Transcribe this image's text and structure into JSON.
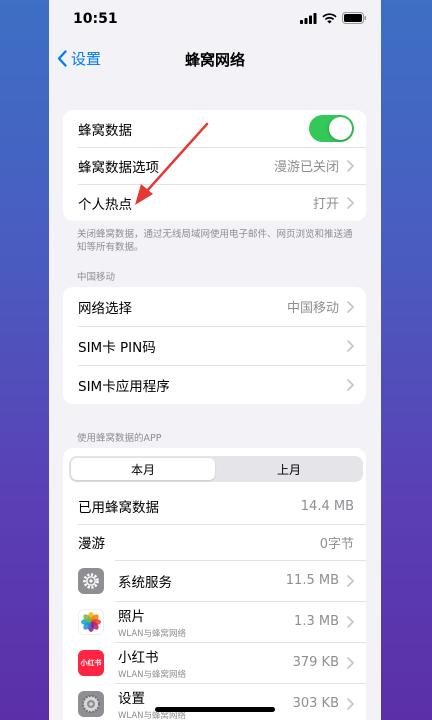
{
  "status": {
    "time": "10:51"
  },
  "nav": {
    "back_label": "设置",
    "title": "蜂窝网络"
  },
  "group1": {
    "cellular_data_label": "蜂窝数据",
    "cellular_data_on": true,
    "options_label": "蜂窝数据选项",
    "options_value": "漫游已关闭",
    "hotspot_label": "个人热点",
    "hotspot_value": "打开"
  },
  "note": "关闭蜂窝数据，通过无线局域网使用电子邮件、网页浏览和推送通知等所有数据。",
  "carrier_section": {
    "header": "中国移动",
    "network_label": "网络选择",
    "network_value": "中国移动",
    "sim_pin_label": "SIM卡 PIN码",
    "sim_apps_label": "SIM卡应用程序"
  },
  "usage_section": {
    "header": "使用蜂窝数据的APP",
    "segment": [
      "本月",
      "上月"
    ],
    "used_label": "已用蜂窝数据",
    "used_value": "14.4 MB",
    "roaming_label": "漫游",
    "roaming_value": "0字节",
    "apps": [
      {
        "name": "系统服务",
        "sub": "",
        "value": "11.5 MB",
        "icon": "gear-icon"
      },
      {
        "name": "照片",
        "sub": "WLAN与蜂窝网络",
        "value": "1.3 MB",
        "icon": "photos-icon"
      },
      {
        "name": "小红书",
        "sub": "WLAN与蜂窝网络",
        "value": "379 KB",
        "icon": "xiaohongshu-icon"
      },
      {
        "name": "设置",
        "sub": "WLAN与蜂窝网络",
        "value": "303 KB",
        "icon": "settings-icon"
      }
    ],
    "xhs_icon_text": "小红书"
  },
  "colors": {
    "accent": "#007aff",
    "toggle_on": "#34c759",
    "annotation_arrow": "#e53935"
  }
}
